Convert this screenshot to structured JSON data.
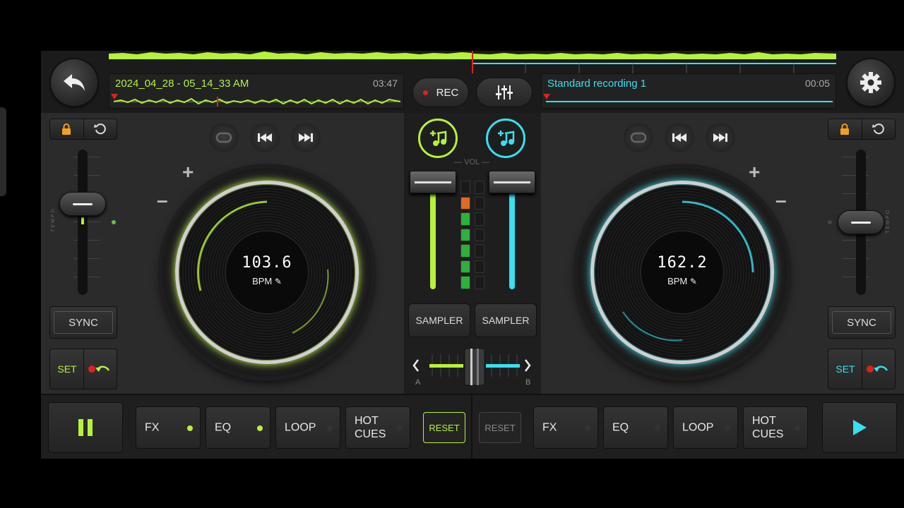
{
  "colors": {
    "deck_a": "#b6f23a",
    "deck_b": "#38e0f0",
    "rec": "#e02020"
  },
  "topbar": {
    "back_icon": "undo-arrow-icon",
    "settings_icon": "gear-icon",
    "deck_a_track": {
      "name": "2024_04_28 - 05_14_33 AM",
      "time": "03:47"
    },
    "deck_b_track": {
      "name": "Standard recording 1",
      "time": "00:05"
    },
    "rec_label": "REC",
    "mixer_icon": "sliders-icon"
  },
  "deck_a": {
    "bpm": "103.6",
    "bpm_label": "BPM",
    "sync_label": "SYNC",
    "set_label": "SET",
    "tempo_label": "TEMPO",
    "buttons": [
      {
        "label": "FX",
        "led_on": true
      },
      {
        "label": "EQ",
        "led_on": true
      },
      {
        "label": "LOOP",
        "led_on": false
      },
      {
        "label": "HOT\nCUES",
        "led_on": false
      }
    ],
    "reset_label": "RESET"
  },
  "deck_b": {
    "bpm": "162.2",
    "bpm_label": "BPM",
    "sync_label": "SYNC",
    "set_label": "SET",
    "tempo_label": "TEMPO",
    "buttons": [
      {
        "label": "FX",
        "led_on": false
      },
      {
        "label": "EQ",
        "led_on": false
      },
      {
        "label": "LOOP",
        "led_on": false
      },
      {
        "label": "HOT\nCUES",
        "led_on": false
      }
    ],
    "reset_label": "RESET"
  },
  "mixer": {
    "vol_label": "VOL",
    "sampler_a": "SAMPLER",
    "sampler_b": "SAMPLER",
    "crossfader_a": "A",
    "crossfader_b": "B"
  }
}
